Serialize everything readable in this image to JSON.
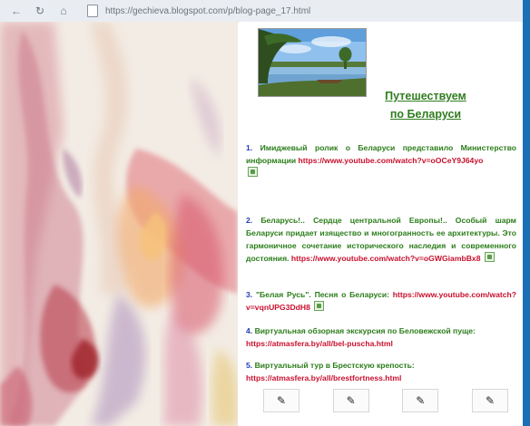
{
  "browser": {
    "url": "https://gechieva.blogspot.com/p/blog-page_17.html"
  },
  "panel": {
    "title_line1": "Путешествуем",
    "title_line2": "по Беларуси"
  },
  "items": [
    {
      "num": "1.",
      "text": "Имиджевый ролик о Беларуси представило Министерство информации",
      "link": "https://www.youtube.com/watch?v=oOCeY9J64yo"
    },
    {
      "num": "2.",
      "text": "Беларусь!.. Сердце центральной Европы!.. Особый шарм Беларуси придает изящество и многогранность ее архитектуры. Это гармоничное сочетание исторического наследия и современного достояния.",
      "link": "https://www.youtube.com/watch?v=oGWGiambBx8"
    },
    {
      "num": "3.",
      "text": "\"Белая Русь\". Песня о Беларуси:",
      "link": "https://www.youtube.com/watch?v=vqnUPG3DdH8"
    },
    {
      "num": "4.",
      "text": "Виртуальная обзорная экскурсия по Беловежской пуще:",
      "link": "https://atmasfera.by/all/bel-puscha.html"
    },
    {
      "num": "5.",
      "text": "Виртуальный тур в Брестскую крепость:",
      "link": "https://atmasfera.by/all/brestfortness.html"
    }
  ],
  "thumbnails": [
    "broken-image-icon",
    "broken-image-icon",
    "broken-image-icon",
    "broken-image-icon"
  ],
  "colors": {
    "title_green": "#2f7d1e",
    "link_red": "#c8102e",
    "number_blue": "#1f3fb3"
  }
}
